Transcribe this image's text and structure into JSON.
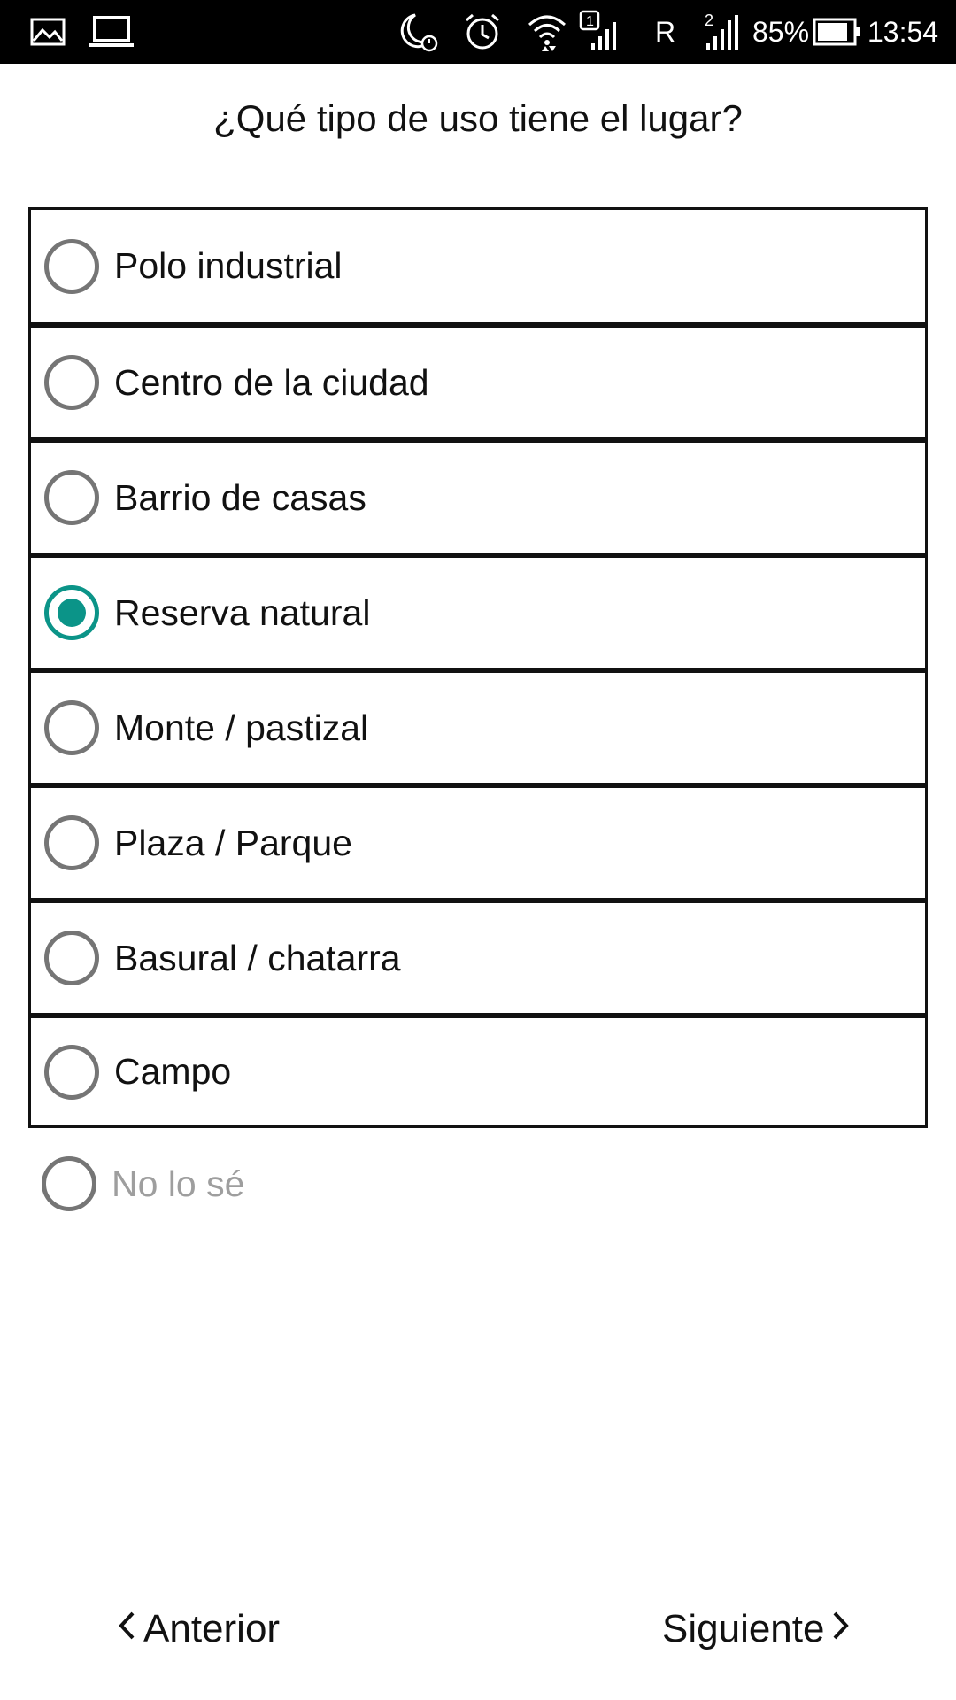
{
  "status_bar": {
    "icons_left": [
      "gallery-icon",
      "laptop-icon"
    ],
    "icons_right": [
      "night-alarm-icon",
      "alarm-icon",
      "wifi-icon",
      "signal-sim1-icon",
      "signal-sim2-icon",
      "battery-icon"
    ],
    "roaming": "R",
    "battery_percent": "85%",
    "time": "13:54"
  },
  "question": {
    "title": "¿Qué tipo de uso tiene el lugar?"
  },
  "options": [
    {
      "label": "Polo industrial",
      "checked": false
    },
    {
      "label": "Centro de la ciudad",
      "checked": false
    },
    {
      "label": "Barrio de casas",
      "checked": false
    },
    {
      "label": "Reserva natural",
      "checked": true
    },
    {
      "label": "Monte / pastizal",
      "checked": false
    },
    {
      "label": "Plaza / Parque",
      "checked": false
    },
    {
      "label": "Basural / chatarra",
      "checked": false
    },
    {
      "label": "Campo",
      "checked": false
    }
  ],
  "unknown_option": {
    "label": "No lo sé",
    "checked": false
  },
  "navigation": {
    "prev_label": "Anterior",
    "next_label": "Siguiente"
  },
  "colors": {
    "accent": "#0b9488",
    "radio_unchecked": "#757575",
    "disabled_text": "#9e9e9e"
  }
}
